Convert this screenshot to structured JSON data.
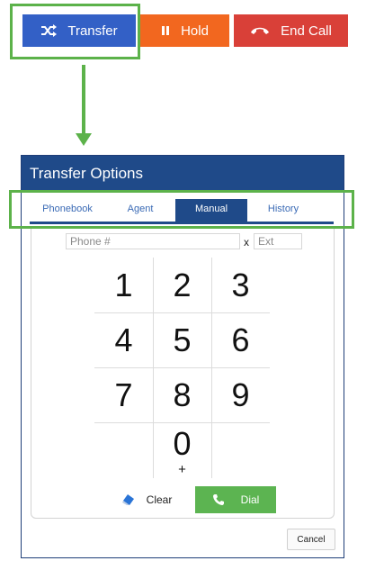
{
  "call_controls": {
    "transfer": {
      "label": "Transfer",
      "icon": "shuffle-icon",
      "color": "#3360c6"
    },
    "hold": {
      "label": "Hold",
      "icon": "pause-icon",
      "color": "#f2671f"
    },
    "end_call": {
      "label": "End Call",
      "icon": "hangup-phone-icon",
      "color": "#d94038"
    }
  },
  "annotation": {
    "highlight_color": "#5cb24a"
  },
  "dialog": {
    "title": "Transfer Options",
    "header_color": "#1f4a89",
    "tabs": [
      {
        "label": "Phonebook",
        "active": false
      },
      {
        "label": "Agent",
        "active": false
      },
      {
        "label": "Manual",
        "active": true
      },
      {
        "label": "History",
        "active": false
      }
    ],
    "phone_field": {
      "placeholder": "Phone #",
      "value": ""
    },
    "ext_separator": "x",
    "ext_field": {
      "placeholder": "Ext",
      "value": ""
    },
    "keypad": {
      "keys": [
        "1",
        "2",
        "3",
        "4",
        "5",
        "6",
        "7",
        "8",
        "9",
        "0"
      ],
      "zero_sub": "+"
    },
    "clear_label": "Clear",
    "dial_label": "Dial",
    "dial_color": "#5cb451",
    "cancel_label": "Cancel"
  }
}
